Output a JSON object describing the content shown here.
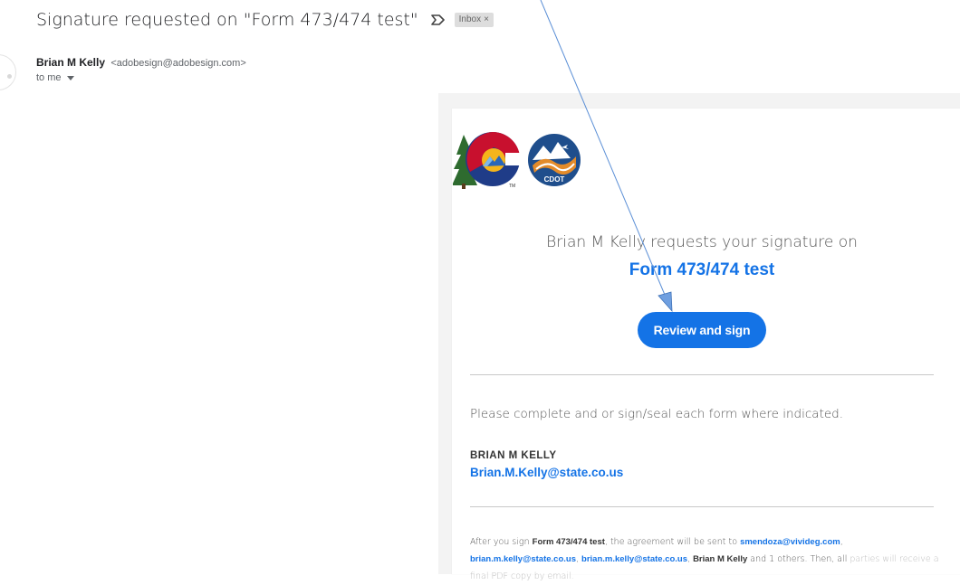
{
  "email": {
    "subject": "Signature requested on \"Form 473/474 test\"",
    "label": "Inbox",
    "label_close": "×",
    "sender_name": "Brian M Kelly",
    "sender_email": "<adobesign@adobesign.com>",
    "to": "to me"
  },
  "card": {
    "logos": {
      "left_logo": "colorado-state-logo",
      "right_logo": "cdot-logo",
      "right_logo_text": "CDOT",
      "tm_mark": "TM"
    },
    "request_line": "Brian M Kelly requests your signature on",
    "document_name": "Form 473/474 test",
    "review_button": "Review and sign",
    "message": "Please complete and or sign/seal each form where indicated.",
    "signer": {
      "name": "BRIAN M KELLY",
      "email": "Brian.M.Kelly@state.co.us"
    },
    "footer": {
      "prefix": "After you sign ",
      "doc": "Form 473/474 test",
      "middle": ", the agreement will be sent to ",
      "recipient1": "smendoza@vivideg.com",
      "sep1": ", ",
      "recipient2": "brian.m.kelly@state.co.us",
      "sep2": ", ",
      "recipient3": "brian.m.kelly@state.co.us",
      "sep3": ", ",
      "recipient4": "Brian M Kelly",
      "tail": " and 1 others. Then, all ",
      "faded": "parties will receive a final PDF copy by email."
    }
  },
  "colors": {
    "accent": "#1473e6",
    "annotation_arrow": "#5b8fd6"
  }
}
